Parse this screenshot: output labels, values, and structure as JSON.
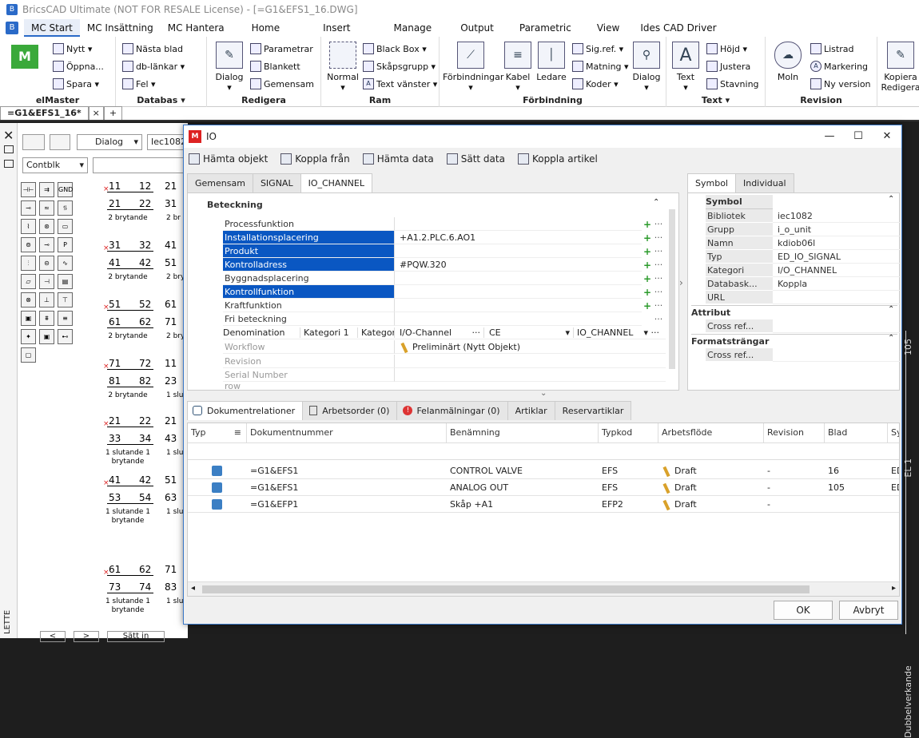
{
  "app": {
    "title": "BricsCAD Ultimate (NOT FOR RESALE License) - [=G1&EFS1_16.DWG]"
  },
  "ribbon_tabs": [
    "MC Start",
    "MC Insättning",
    "MC Hantera",
    "Home",
    "Insert",
    "Manage",
    "Output",
    "Parametric",
    "View",
    "Ides CAD Driver"
  ],
  "ribbon": {
    "elmaster": {
      "title": "elMaster",
      "nytt": "Nytt",
      "oppna": "Öppna...",
      "spara": "Spara"
    },
    "databas": {
      "title": "Databas",
      "nasta_blad": "Nästa blad",
      "db_lankar": "db-länkar",
      "fel": "Fel"
    },
    "redigera": {
      "title": "Redigera",
      "dialog": "Dialog",
      "parametrar": "Parametrar",
      "blankett": "Blankett",
      "gemensam": "Gemensam"
    },
    "ram": {
      "title": "Ram",
      "normal": "Normal",
      "black_box": "Black Box",
      "skapsgrupp": "Skåpsgrupp",
      "text_vanster": "Text vänster"
    },
    "forbindning": {
      "title": "Förbindning",
      "forbindningar": "Förbindningar",
      "kabel": "Kabel",
      "ledare": "Ledare",
      "sig_ref": "Sig.ref.",
      "matning": "Matning",
      "koder": "Koder",
      "dialog": "Dialog"
    },
    "text": {
      "title": "Text",
      "text": "Text",
      "hojd": "Höjd",
      "justera": "Justera",
      "stavning": "Stavning"
    },
    "revision": {
      "title": "Revision",
      "moln": "Moln",
      "listrad": "Listrad",
      "markering": "Markering",
      "ny_version": "Ny version"
    },
    "kopiera": {
      "line1": "Kopiera",
      "line2": "Redigera"
    }
  },
  "doc_tab": "=G1&EFS1_16*",
  "left_panel": {
    "dialog_select": "Dialog",
    "lib_select": "Iec1082",
    "filter_select": "Contblk",
    "vertical_label": "LETTE",
    "footer": [
      "<",
      ">",
      "Sätt in"
    ],
    "switches": [
      {
        "top": [
          "11",
          "12"
        ],
        "bot": [
          "21",
          "22"
        ],
        "label": [
          "2 brytande"
        ]
      },
      {
        "top": [
          "31",
          "32"
        ],
        "bot": [
          "41",
          "42"
        ],
        "label": [
          "2 brytande"
        ]
      },
      {
        "top": [
          "51",
          "52"
        ],
        "bot": [
          "61",
          "62"
        ],
        "label": [
          "2 brytande"
        ]
      },
      {
        "top": [
          "71",
          "72"
        ],
        "bot": [
          "81",
          "82"
        ],
        "label": [
          "2 brytande"
        ]
      },
      {
        "top": [
          "21",
          "22"
        ],
        "bot": [
          "33",
          "34"
        ],
        "label": [
          "1 slutande 1",
          "brytande"
        ]
      },
      {
        "top": [
          "41",
          "42"
        ],
        "bot": [
          "53",
          "54"
        ],
        "label": [
          "1 slutande 1",
          "brytande"
        ]
      },
      {
        "top": [
          "61",
          "62"
        ],
        "bot": [
          "73",
          "74"
        ],
        "label": [
          "1 slutande 1",
          "brytande"
        ]
      }
    ],
    "switches_col2": [
      {
        "top": [
          "21"
        ],
        "bot": [
          "31"
        ],
        "label": "2 br"
      },
      {
        "top": [
          "41"
        ],
        "bot": [
          "51"
        ],
        "label": "2 bry"
      },
      {
        "top": [
          "61"
        ],
        "bot": [
          "71"
        ],
        "label": "2 bry"
      },
      {
        "top": [
          "11"
        ],
        "bot": [
          "23"
        ],
        "label": "1 slut"
      },
      {
        "top": [
          "21"
        ],
        "bot": [
          "43"
        ],
        "label": "1 slut"
      },
      {
        "top": [
          "51"
        ],
        "bot": [
          "63"
        ],
        "label": "1 slut"
      },
      {
        "top": [
          "71"
        ],
        "bot": [
          "83"
        ],
        "label": "1 slut"
      }
    ]
  },
  "cad_side_text": [
    "Dubbelverkande",
    "EL 1",
    "105"
  ],
  "dialog": {
    "title": "IO",
    "toolbar": [
      "Hämta objekt",
      "Koppla från",
      "Hämta data",
      "Sätt data",
      "Koppla artikel"
    ],
    "tabs": [
      "Gemensam",
      "SIGNAL",
      "IO_CHANNEL"
    ],
    "section": "Beteckning",
    "properties": [
      {
        "name": "Processfunktion",
        "value": "",
        "sel": false
      },
      {
        "name": "Installationsplacering",
        "value": "+A1.2.PLC.6.AO1",
        "sel": true
      },
      {
        "name": "Produkt",
        "value": "",
        "sel": true
      },
      {
        "name": "Kontrolladress",
        "value": "#PQW.320",
        "sel": true
      },
      {
        "name": "Byggnadsplacering",
        "value": "",
        "sel": false
      },
      {
        "name": "Kontrollfunktion",
        "value": "",
        "sel": true
      },
      {
        "name": "Kraftfunktion",
        "value": "",
        "sel": false
      },
      {
        "name": "Fri beteckning",
        "value": "",
        "sel": false
      }
    ],
    "denomination": {
      "label": "Denomination",
      "kat1": "Kategori 1",
      "kat2": "Kategori 2",
      "v1": "I/O-Channel",
      "v2": "CE",
      "v3": "IO_CHANNEL"
    },
    "workflow": {
      "label": "Workflow",
      "value": "Preliminärt (Nytt Objekt)"
    },
    "extra_rows": [
      "Revision",
      "Serial Number",
      "row"
    ],
    "side_tabs": [
      "Symbol",
      "Individual"
    ],
    "symbol_section": "Symbol",
    "symbol_rows": [
      {
        "k": "Bibliotek",
        "v": "iec1082"
      },
      {
        "k": "Grupp",
        "v": "i_o_unit"
      },
      {
        "k": "Namn",
        "v": "kdiob06l"
      },
      {
        "k": "Typ",
        "v": "ED_IO_SIGNAL"
      },
      {
        "k": "Kategori",
        "v": "I/O_CHANNEL"
      },
      {
        "k": "Databask...",
        "v": "Koppla"
      },
      {
        "k": "URL",
        "v": ""
      }
    ],
    "attribut_section": "Attribut",
    "attribut_row": "Cross ref...",
    "format_section": "Formatsträngar",
    "format_row": "Cross ref...",
    "bottom_tabs": [
      "Dokumentrelationer",
      "Arbetsorder (0)",
      "Felanmälningar (0)",
      "Artiklar",
      "Reservartiklar"
    ],
    "grid_headers": [
      "Typ",
      "Dokumentnummer",
      "Benämning",
      "Typkod",
      "Arbetsflöde",
      "Revision",
      "Blad",
      "Sy"
    ],
    "grid_rows": [
      {
        "doc": "=G1&EFS1",
        "ben": "CONTROL VALVE",
        "typ": "EFS",
        "flow": "Draft",
        "rev": "-",
        "blad": "16",
        "sy": "ED"
      },
      {
        "doc": "=G1&EFS1",
        "ben": "ANALOG OUT",
        "typ": "EFS",
        "flow": "Draft",
        "rev": "-",
        "blad": "105",
        "sy": "ED"
      },
      {
        "doc": "=G1&EFP1",
        "ben": "Skåp +A1",
        "typ": "EFP2",
        "flow": "Draft",
        "rev": "-",
        "blad": "",
        "sy": ""
      }
    ],
    "ok": "OK",
    "cancel": "Avbryt"
  }
}
